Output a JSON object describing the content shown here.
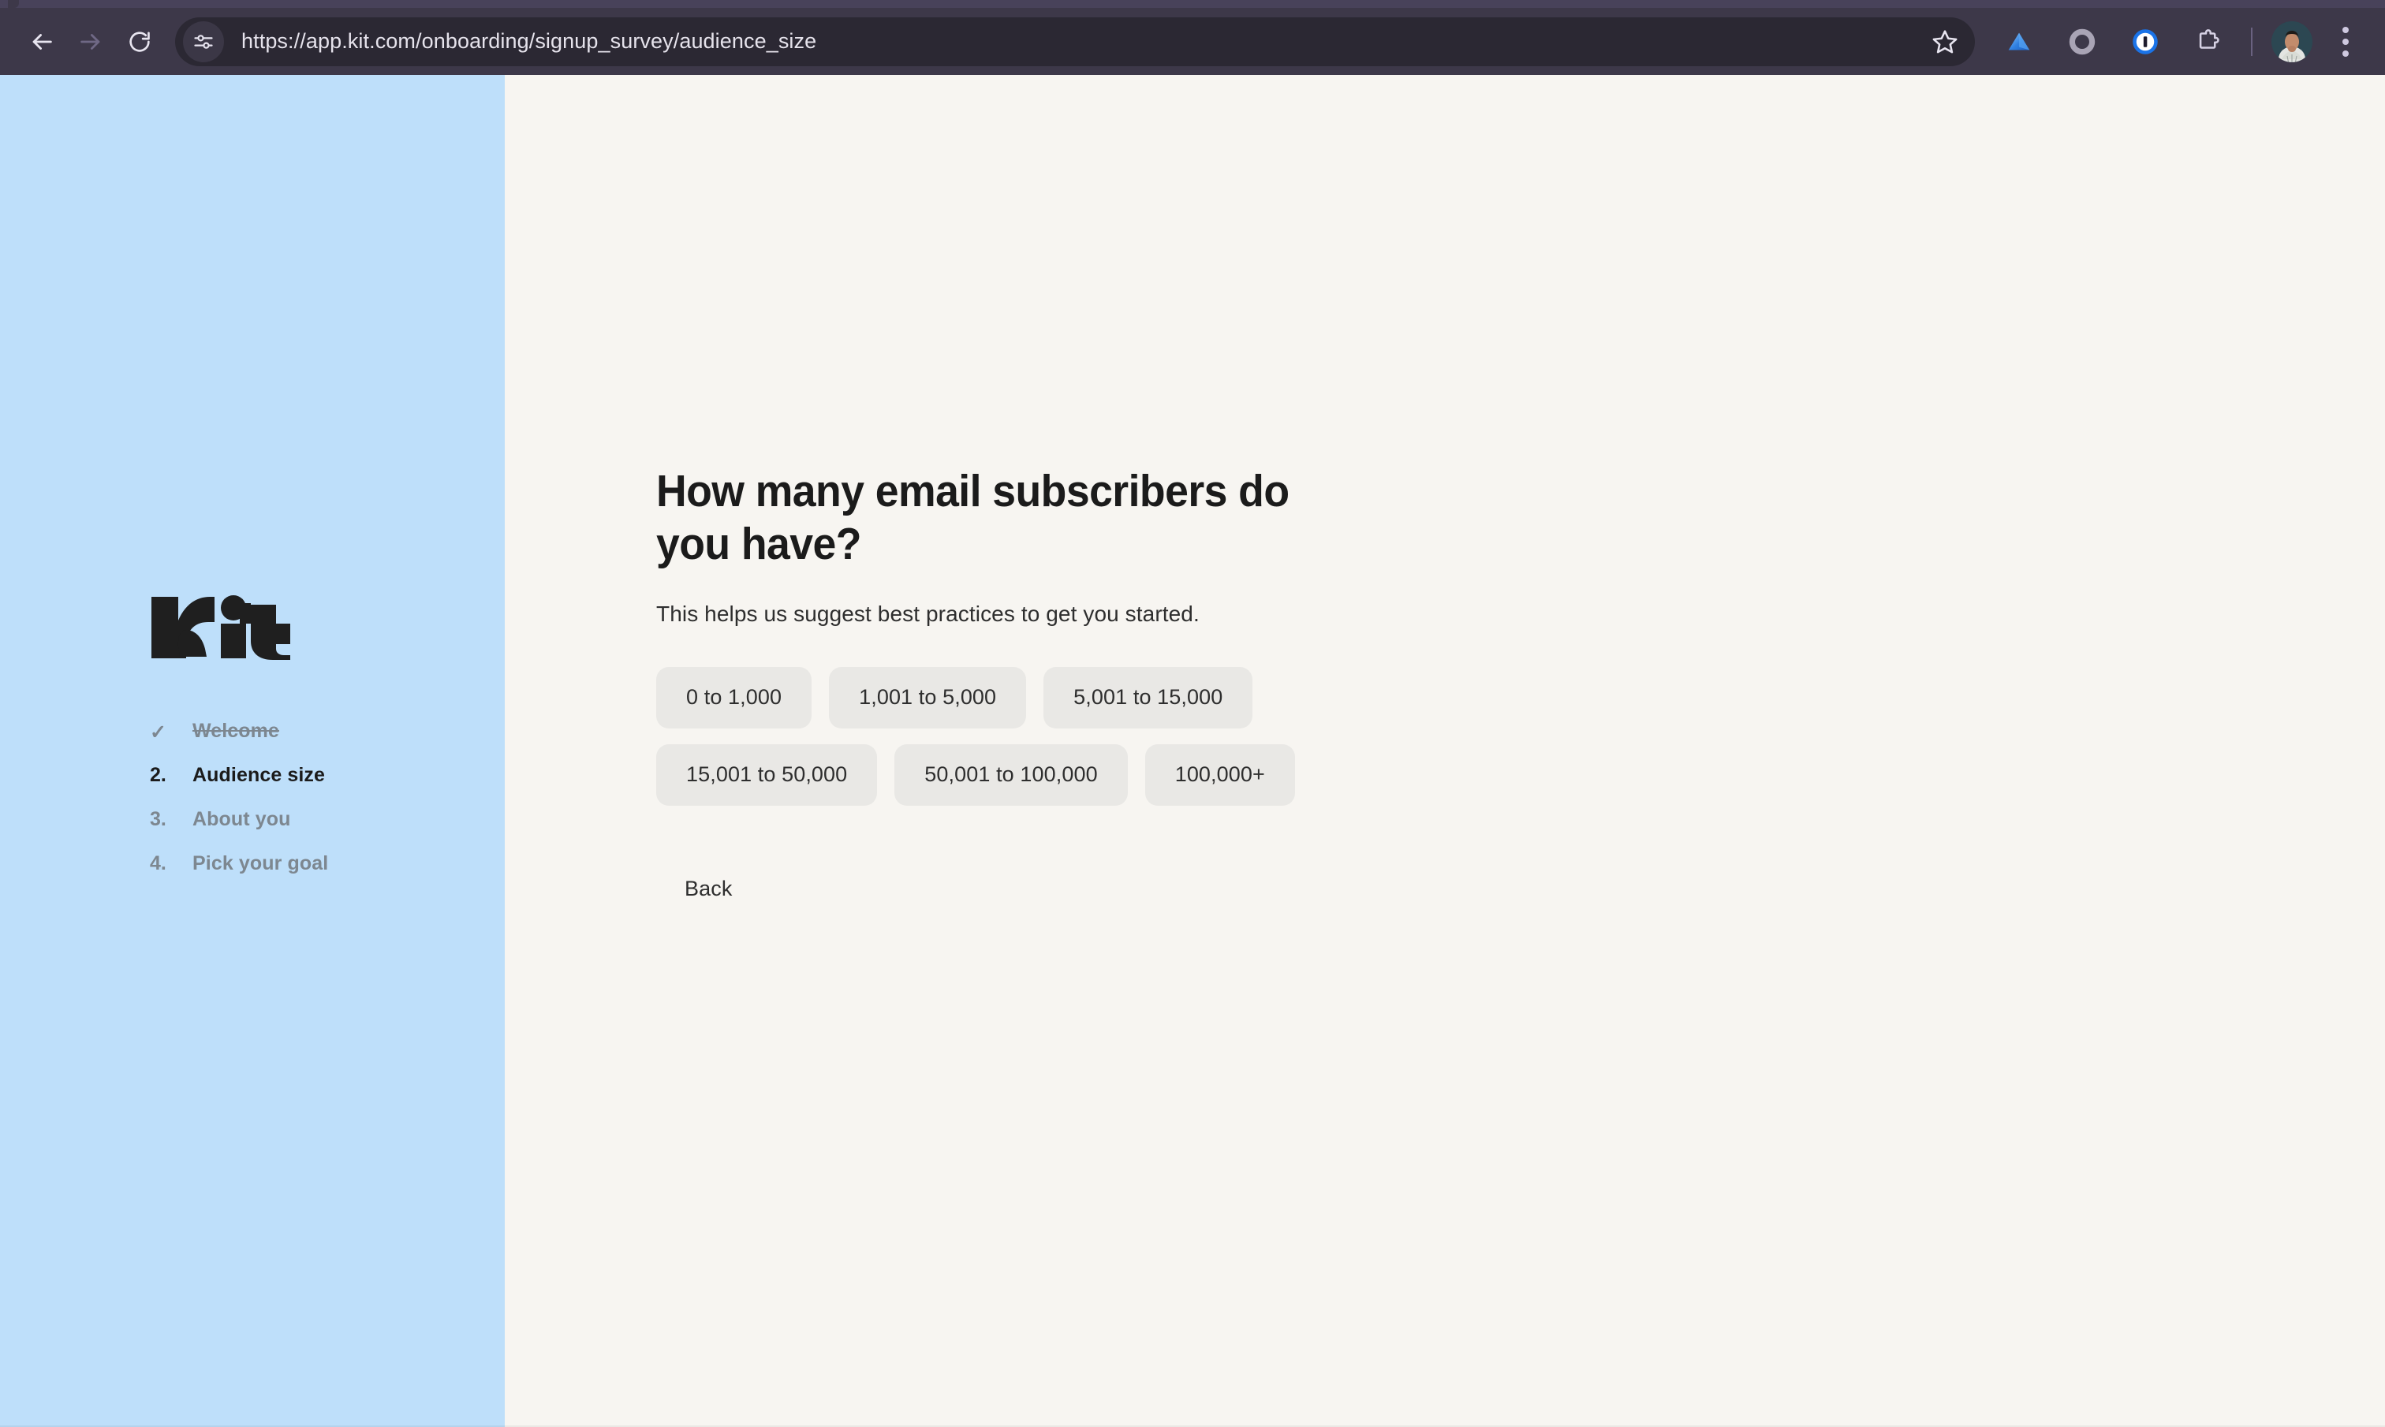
{
  "browser": {
    "url": "https://app.kit.com/onboarding/signup_survey/audience_size",
    "back_label": "Back",
    "forward_label": "Forward",
    "reload_label": "Reload",
    "site_settings_label": "View site information",
    "bookmark_label": "Bookmark this tab",
    "extensions": [
      {
        "name": "vercel-icon",
        "label": "Vercel"
      },
      {
        "name": "ring-icon",
        "label": "Extension"
      },
      {
        "name": "onepassword-icon",
        "label": "1Password"
      },
      {
        "name": "puzzle-icon",
        "label": "Extensions"
      }
    ],
    "profile_label": "Profile",
    "menu_label": "Customize and control Google Chrome",
    "colors": {
      "toolbar": "#3D3849",
      "omnibox": "#2B2833",
      "url_text": "#E6E3EC"
    }
  },
  "sidebar": {
    "logo_text": "Kit",
    "steps": [
      {
        "marker": "✓",
        "label": "Welcome",
        "state": "done"
      },
      {
        "marker": "2.",
        "label": "Audience size",
        "state": "active"
      },
      {
        "marker": "3.",
        "label": "About you",
        "state": "upcoming"
      },
      {
        "marker": "4.",
        "label": "Pick your goal",
        "state": "upcoming"
      }
    ],
    "colors": {
      "background": "#BEDFFA",
      "active_text": "#1B1B1B",
      "muted_text": "#7D8790"
    }
  },
  "main": {
    "heading": "How many email subscribers do you have?",
    "subheading": "This helps us suggest best practices to get you started.",
    "options": [
      "0 to 1,000",
      "1,001 to 5,000",
      "5,001 to 15,000",
      "15,001 to 50,000",
      "50,001 to 100,000",
      "100,000+"
    ],
    "back_label": "Back",
    "colors": {
      "background": "#F7F5F1",
      "option_background": "#E9E8E5",
      "text": "#1B1B1B"
    }
  }
}
